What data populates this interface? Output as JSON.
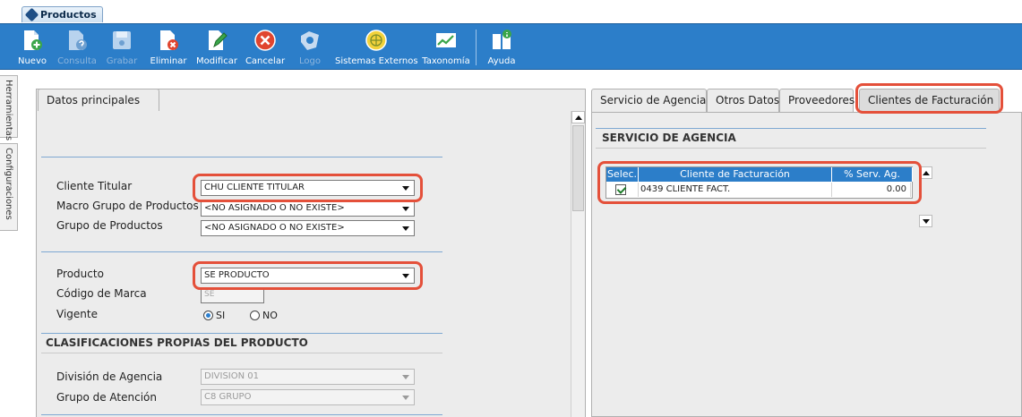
{
  "app_tab": {
    "label": "Productos"
  },
  "toolbar": {
    "buttons": [
      {
        "label": "Nuevo",
        "icon": "new-doc-icon",
        "enabled": true
      },
      {
        "label": "Consulta",
        "icon": "query-doc-icon",
        "enabled": false
      },
      {
        "label": "Grabar",
        "icon": "save-disk-icon",
        "enabled": false
      },
      {
        "label": "Eliminar",
        "icon": "delete-doc-icon",
        "enabled": true
      },
      {
        "label": "Modificar",
        "icon": "edit-pencil-icon",
        "enabled": true
      },
      {
        "label": "Cancelar",
        "icon": "cancel-icon",
        "enabled": true
      },
      {
        "label": "Logo",
        "icon": "logo-icon",
        "enabled": false
      },
      {
        "label": "Sistemas Externos",
        "icon": "globe-icon",
        "enabled": true
      },
      {
        "label": "Taxonomía",
        "icon": "chart-icon",
        "enabled": true
      },
      {
        "label": "Ayuda",
        "icon": "help-book-icon",
        "enabled": true
      }
    ]
  },
  "side_tabs": {
    "tools": "Herramientas",
    "config": "Configuraciones"
  },
  "left": {
    "tab_label": "Datos principales",
    "cliente_titular": {
      "label": "Cliente Titular",
      "value": "CHU CLIENTE TITULAR"
    },
    "macro_grupo": {
      "label": "Macro Grupo de Productos",
      "value": "<NO ASIGNADO O NO EXISTE>"
    },
    "grupo": {
      "label": "Grupo de Productos",
      "value": "<NO ASIGNADO O NO EXISTE>"
    },
    "producto": {
      "label": "Producto",
      "value": "SE PRODUCTO"
    },
    "codigo_marca": {
      "label": "Código de Marca",
      "value": "SE"
    },
    "vigente": {
      "label": "Vigente",
      "si": "SI",
      "no": "NO",
      "selected": "SI"
    },
    "clasificaciones_title": "CLASIFICACIONES PROPIAS DEL PRODUCTO",
    "division": {
      "label": "División de Agencia",
      "value": "DIVISION 01"
    },
    "grupo_atencion": {
      "label": "Grupo de Atención",
      "value": "C8 GRUPO"
    }
  },
  "right": {
    "tabs": [
      {
        "label": "Servicio de Agencia"
      },
      {
        "label": "Otros Datos"
      },
      {
        "label": "Proveedores"
      },
      {
        "label": "Clientes de Facturación"
      }
    ],
    "active_tab": "Clientes de Facturación",
    "section_title": "SERVICIO DE AGENCIA",
    "grid": {
      "headers": [
        "Selec.",
        "Cliente de Facturación",
        "% Serv. Ag."
      ],
      "rows": [
        {
          "selected": true,
          "cliente": "0439 CLIENTE FACT.",
          "pct": "0.00"
        }
      ]
    }
  },
  "colors": {
    "toolbar": "#2c7ec9",
    "highlight": "#e4503a",
    "panel": "#ececec"
  }
}
